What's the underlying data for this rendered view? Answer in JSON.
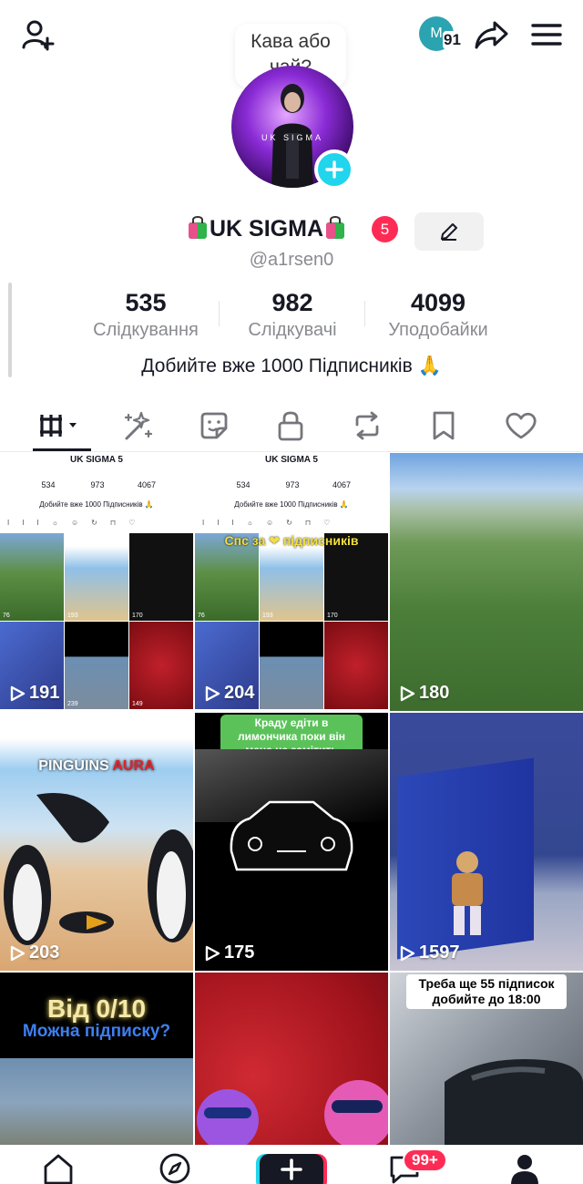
{
  "topbar": {
    "account_initial": "M",
    "account_notifications": "91",
    "bubble_text": "Кава або чай?"
  },
  "profile": {
    "name": "UK SIGMA",
    "name_badge": "5",
    "handle": "@a1rsen0",
    "avatar_text": "UK SIGMA",
    "stats": [
      {
        "value": "535",
        "label": "Слідкування"
      },
      {
        "value": "982",
        "label": "Слідкувачі"
      },
      {
        "value": "4099",
        "label": "Уподобайки"
      }
    ],
    "bio": "Добийте вже 1000 Підписників 🙏"
  },
  "tabs": [
    "videos-grid-icon",
    "reposts-sparkle-icon",
    "stickers-icon",
    "private-lock-icon",
    "repost-icon",
    "bookmark-icon",
    "heart-icon"
  ],
  "videos": [
    {
      "views": "191",
      "kind": "mini-profile"
    },
    {
      "views": "204",
      "kind": "mini-profile",
      "overlay": "Спс за ❤ підписників"
    },
    {
      "views": "180",
      "kind": "landscape"
    },
    {
      "views": "203",
      "kind": "penguins",
      "title": "PINGUINS",
      "title_accent": "AURA"
    },
    {
      "views": "175",
      "kind": "car",
      "caption": "Краду едіти в лимончика поки він мене не замітить"
    },
    {
      "views": "1597",
      "kind": "game"
    },
    {
      "views": "",
      "kind": "rating",
      "title": "Від 0/10",
      "subtitle": "Можна підписку?"
    },
    {
      "views": "",
      "kind": "brawl"
    },
    {
      "views": "",
      "kind": "car-dark",
      "caption": "Треба ще 55 підписок добийте до 18:00"
    }
  ],
  "mini": {
    "header": "UK SIGMA 5",
    "stats": [
      "534",
      "973",
      "4067"
    ],
    "stats2": [
      "534",
      "973",
      "4067"
    ],
    "bio": "Добийте вже 1000 Підписників 🙏",
    "thumb_views_a": [
      "76",
      "193",
      "170"
    ],
    "thumb_views_b": [
      "76",
      "193",
      "170"
    ],
    "thumb_views_c": [
      "239",
      "149"
    ],
    "penguins": "PINGUINS AURA",
    "rating": "Від 0/10",
    "rating_sub": "Можна підписку?"
  },
  "bottomnav": {
    "inbox_badge": "99+"
  },
  "colors": {
    "accent_red": "#fe2c55",
    "accent_cyan": "#20d5ec",
    "text": "#161823",
    "muted": "#8a8b91"
  }
}
